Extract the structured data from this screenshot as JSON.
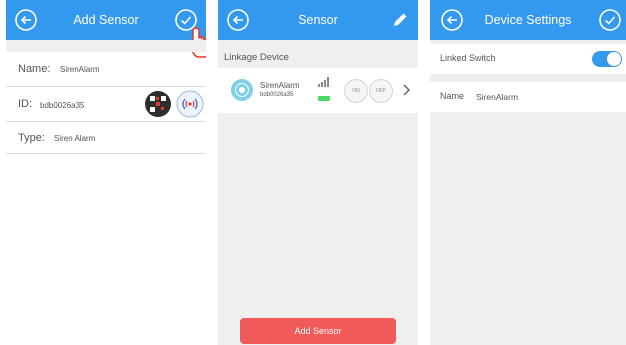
{
  "screen1": {
    "title": "Add Sensor",
    "fields": {
      "name_label": "Name:",
      "name_value": "SirenAlarm",
      "id_label": "ID:",
      "id_value": "bdb0026a35",
      "type_label": "Type:",
      "type_value": "Siren Alarm"
    }
  },
  "screen2": {
    "title": "Sensor",
    "section_label": "Linkage Device",
    "device": {
      "name": "SirenAlarm",
      "id": "bdb0026a35",
      "on_label": "ON",
      "off_label": "OFF"
    },
    "add_button": "Add Sensor"
  },
  "screen3": {
    "title": "Device Settings",
    "linked_switch_label": "Linked Switch",
    "linked_switch_on": true,
    "name_label": "Name",
    "name_value": "SirenAlarm"
  },
  "colors": {
    "accent": "#3399ee",
    "danger": "#f15a5a",
    "battery": "#4cd964"
  },
  "icons": [
    "back-icon",
    "check-icon",
    "pointer-hand-icon",
    "edit-icon",
    "chevron-right-icon",
    "signal-icon",
    "battery-icon",
    "sensor-icon",
    "qr-scan-icon",
    "radar-icon"
  ]
}
